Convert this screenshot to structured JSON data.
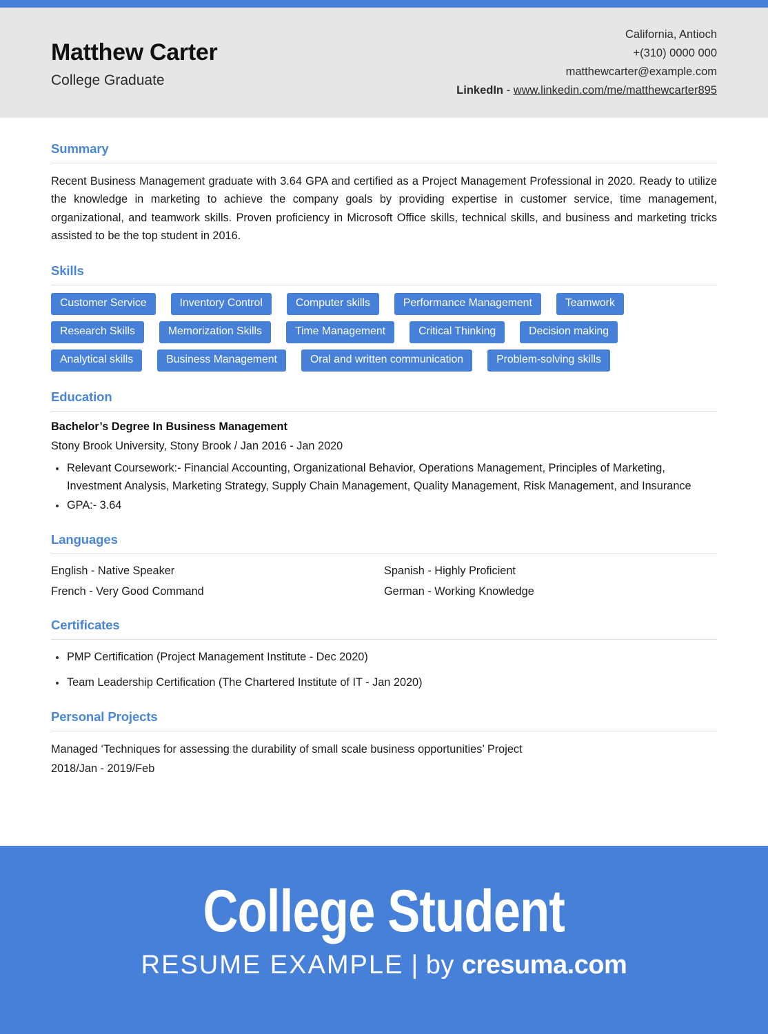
{
  "theme": {
    "accent": "#4680d8",
    "heading_blue": "#4a86d8",
    "header_bg": "#e6e6e6"
  },
  "header": {
    "full_name": "Matthew Carter",
    "job_title": "College Graduate",
    "contact": {
      "location": "California, Antioch",
      "phone": "+(310) 0000 000",
      "email": "matthewcarter@example.com",
      "linkedin_label": "LinkedIn",
      "linkedin_separator": "-",
      "linkedin_url": "www.linkedin.com/me/matthewcarter895"
    }
  },
  "sections": {
    "summary": {
      "title": "Summary",
      "text": "Recent Business Management graduate with 3.64 GPA and certified as a Project Management Professional in 2020. Ready to utilize the knowledge in marketing to achieve the company goals by providing expertise in customer service, time management, organizational, and teamwork skills. Proven proficiency in Microsoft Office skills, technical skills, and business and marketing tricks assisted to be the top student in 2016."
    },
    "skills": {
      "title": "Skills",
      "rows": [
        [
          "Customer Service",
          "Inventory Control",
          "Computer skills",
          "Performance Management",
          "Teamwork"
        ],
        [
          "Research Skills",
          "Memorization Skills",
          "Time Management",
          "Critical Thinking",
          "Decision making"
        ],
        [
          "Analytical skills",
          "Business Management",
          "Oral and written communication",
          "Problem-solving skills"
        ]
      ]
    },
    "education": {
      "title": "Education",
      "degree": "Bachelor’s Degree In Business Management",
      "meta": "Stony Brook University, Stony Brook / Jan 2016 - Jan 2020",
      "bullets": [
        "Relevant Coursework:- Financial Accounting, Organizational Behavior, Operations Management, Principles of Marketing, Investment Analysis, Marketing Strategy, Supply Chain Management, Quality Management, Risk Management, and Insurance",
        "GPA:- 3.64"
      ]
    },
    "languages": {
      "title": "Languages",
      "items": [
        "English - Native Speaker",
        "Spanish - Highly Proficient",
        "French - Very Good Command",
        "German - Working Knowledge"
      ]
    },
    "certificates": {
      "title": "Certificates",
      "bullets": [
        "PMP Certification  (Project Management Institute  -  Dec 2020)",
        "Team Leadership Certification  (The Chartered Institute of IT  -  Jan 2020)"
      ]
    },
    "projects": {
      "title": "Personal Projects",
      "line1": "Managed ‘Techniques for assessing the durability of small scale business opportunities’ Project",
      "line2": "2018/Jan - 2019/Feb"
    }
  },
  "footer": {
    "title": "College Student",
    "subtitle_main": "RESUME EXAMPLE",
    "subtitle_pipe": "|",
    "subtitle_by": "by",
    "subtitle_brand": "cresuma.com"
  }
}
